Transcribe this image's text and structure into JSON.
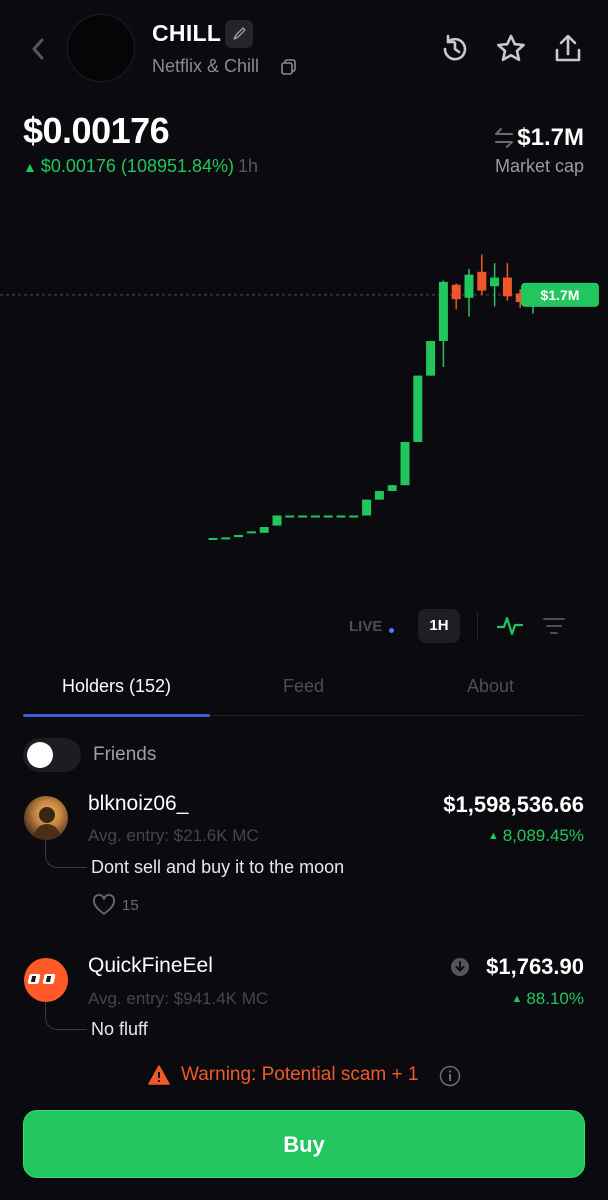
{
  "token": {
    "symbol": "CHILL",
    "name": "Netflix & Chill",
    "price": "$0.00176",
    "change": "$0.00176 (108951.84%)",
    "change_period": "1h",
    "market_cap": "$1.7M",
    "market_cap_label": "Market cap"
  },
  "header_icons": [
    "back-arrow-icon",
    "history-icon",
    "star-icon",
    "share-icon"
  ],
  "chart_data": {
    "type": "candlestick",
    "series": [
      {
        "name": "",
        "candles": [
          {
            "open": 0.014,
            "close": 0.014,
            "high": 0.014,
            "low": 0.014
          },
          {
            "open": 0.016,
            "close": 0.018,
            "high": 0.018,
            "low": 0.016
          },
          {
            "open": 0.02,
            "close": 0.035,
            "high": 0.035,
            "low": 0.02
          },
          {
            "open": 0.05,
            "close": 0.06,
            "high": 0.06,
            "low": 0.05
          },
          {
            "open": 0.05,
            "close": 0.09,
            "high": 0.09,
            "low": 0.05
          },
          {
            "open": 0.1,
            "close": 0.17,
            "high": 0.17,
            "low": 0.1
          },
          {
            "open": 0.17,
            "close": 0.17,
            "high": 0.17,
            "low": 0.17
          },
          {
            "open": 0.17,
            "close": 0.17,
            "high": 0.17,
            "low": 0.17
          },
          {
            "open": 0.17,
            "close": 0.17,
            "high": 0.17,
            "low": 0.17
          },
          {
            "open": 0.17,
            "close": 0.17,
            "high": 0.17,
            "low": 0.17
          },
          {
            "open": 0.17,
            "close": 0.17,
            "high": 0.17,
            "low": 0.17
          },
          {
            "open": 0.17,
            "close": 0.17,
            "high": 0.17,
            "low": 0.17
          },
          {
            "open": 0.17,
            "close": 0.28,
            "high": 0.28,
            "low": 0.17
          },
          {
            "open": 0.28,
            "close": 0.34,
            "high": 0.34,
            "low": 0.28
          },
          {
            "open": 0.34,
            "close": 0.38,
            "high": 0.38,
            "low": 0.34
          },
          {
            "open": 0.38,
            "close": 0.68,
            "high": 0.68,
            "low": 0.38
          },
          {
            "open": 0.68,
            "close": 1.14,
            "high": 1.14,
            "low": 0.68
          },
          {
            "open": 1.14,
            "close": 1.38,
            "high": 1.38,
            "low": 1.14
          },
          {
            "open": 1.38,
            "close": 1.79,
            "high": 1.8,
            "low": 1.2
          },
          {
            "open": 1.77,
            "close": 1.67,
            "high": 1.78,
            "low": 1.6
          },
          {
            "open": 1.68,
            "close": 1.84,
            "high": 1.88,
            "low": 1.55
          },
          {
            "open": 1.86,
            "close": 1.73,
            "high": 1.98,
            "low": 1.7
          },
          {
            "open": 1.76,
            "close": 1.82,
            "high": 1.92,
            "low": 1.62
          },
          {
            "open": 1.82,
            "close": 1.69,
            "high": 1.92,
            "low": 1.66
          },
          {
            "open": 1.71,
            "close": 1.65,
            "high": 1.74,
            "low": 1.61
          },
          {
            "open": 1.66,
            "close": 1.7,
            "high": 1.72,
            "low": 1.57
          }
        ]
      }
    ],
    "current_label": "$1.7M",
    "current_value": 1.7,
    "ylim": [
      0,
      2.15
    ],
    "colors": {
      "up": "#22c55e",
      "down": "#f0562c"
    }
  },
  "controls": {
    "live_label": "LIVE",
    "timeframe": "1H"
  },
  "tabs": [
    {
      "label": "Holders (152)",
      "active": true
    },
    {
      "label": "Feed",
      "active": false
    },
    {
      "label": "About",
      "active": false
    }
  ],
  "friends": {
    "label": "Friends",
    "enabled": false
  },
  "holders": [
    {
      "name": "blknoiz06_",
      "avg_entry": "Avg. entry: $21.6K MC",
      "value": "$1,598,536.66",
      "pct": "8,089.45%",
      "comment": "Dont sell and buy it to the moon",
      "likes": "15"
    },
    {
      "name": "QuickFineEel",
      "avg_entry": "Avg. entry: $941.4K MC",
      "value": "$1,763.90",
      "pct": "88.10%",
      "comment": "No fluff"
    }
  ],
  "warning": {
    "text": "Warning: Potential scam + 1"
  },
  "buy_button": {
    "label": "Buy"
  },
  "colors": {
    "background": "#0a0a0f",
    "accent_green": "#22c55e",
    "accent_red": "#f0562c",
    "tab_underline": "#3d5bd6"
  }
}
